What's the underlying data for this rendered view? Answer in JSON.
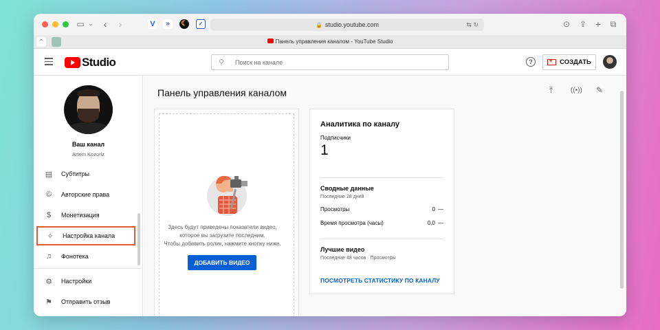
{
  "browser": {
    "url": "studio.youtube.com",
    "tab_title": "Панель управления каналом - YouTube Studio"
  },
  "header": {
    "logo_text": "Studio",
    "search_placeholder": "Поиск на канале",
    "create_label": "СОЗДАТЬ"
  },
  "sidebar": {
    "channel_title": "Ваш канал",
    "channel_owner": "Artem Kozoriz",
    "items": [
      {
        "label": "Субтитры",
        "icon": "subtitles-icon"
      },
      {
        "label": "Авторские права",
        "icon": "copyright-icon"
      },
      {
        "label": "Монетизация",
        "icon": "dollar-icon"
      },
      {
        "label": "Настройка канала",
        "icon": "magic-wand-icon",
        "active": true
      },
      {
        "label": "Фонотека",
        "icon": "music-library-icon"
      }
    ],
    "bottom_items": [
      {
        "label": "Настройки",
        "icon": "gear-icon"
      },
      {
        "label": "Отправить отзыв",
        "icon": "feedback-icon"
      }
    ]
  },
  "main": {
    "title": "Панель управления каналом",
    "upload": {
      "text_line1": "Здесь будут приведены показатели видео,",
      "text_line2": "которое вы загрузите последним.",
      "text_line3": "Чтобы добавить ролик, нажмите кнопку ниже.",
      "button": "ДОБАВИТЬ ВИДЕО"
    },
    "analytics": {
      "title": "Аналитика по каналу",
      "subscribers_label": "Подписчики",
      "subscribers_value": "1",
      "summary_title": "Сводные данные",
      "summary_period": "Последние 28 дней",
      "rows": [
        {
          "label": "Просмотры",
          "value": "0",
          "trend": "—"
        },
        {
          "label": "Время просмотра (часы)",
          "value": "0,0",
          "trend": "—"
        }
      ],
      "top_title": "Лучшие видео",
      "top_period": "Последние 48 часов · Просмотры",
      "link": "ПОСМОТРЕТЬ СТАТИСТИКУ ПО КАНАЛУ"
    }
  },
  "colors": {
    "accent_blue": "#065fd4",
    "youtube_red": "#ff0000",
    "highlight_border": "#e25a3b"
  }
}
